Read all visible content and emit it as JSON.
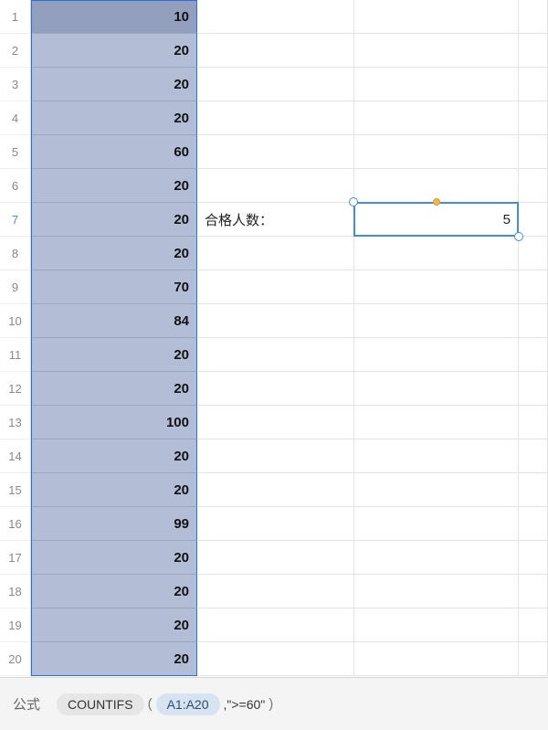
{
  "rows": [
    {
      "n": "1",
      "a": "10"
    },
    {
      "n": "2",
      "a": "20"
    },
    {
      "n": "3",
      "a": "20"
    },
    {
      "n": "4",
      "a": "20"
    },
    {
      "n": "5",
      "a": "60"
    },
    {
      "n": "6",
      "a": "20"
    },
    {
      "n": "7",
      "a": "20",
      "b": "合格人数：",
      "c": "5"
    },
    {
      "n": "8",
      "a": "20"
    },
    {
      "n": "9",
      "a": "70"
    },
    {
      "n": "10",
      "a": "84"
    },
    {
      "n": "11",
      "a": "20"
    },
    {
      "n": "12",
      "a": "20"
    },
    {
      "n": "13",
      "a": "100"
    },
    {
      "n": "14",
      "a": "20"
    },
    {
      "n": "15",
      "a": "20"
    },
    {
      "n": "16",
      "a": "99"
    },
    {
      "n": "17",
      "a": "20"
    },
    {
      "n": "18",
      "a": "20"
    },
    {
      "n": "19",
      "a": "20"
    },
    {
      "n": "20",
      "a": "20"
    }
  ],
  "selected_row": "7",
  "formula": {
    "label": "公式",
    "func": "COUNTIFS",
    "range": "A1:A20",
    "criteria": ",\">=60\""
  }
}
